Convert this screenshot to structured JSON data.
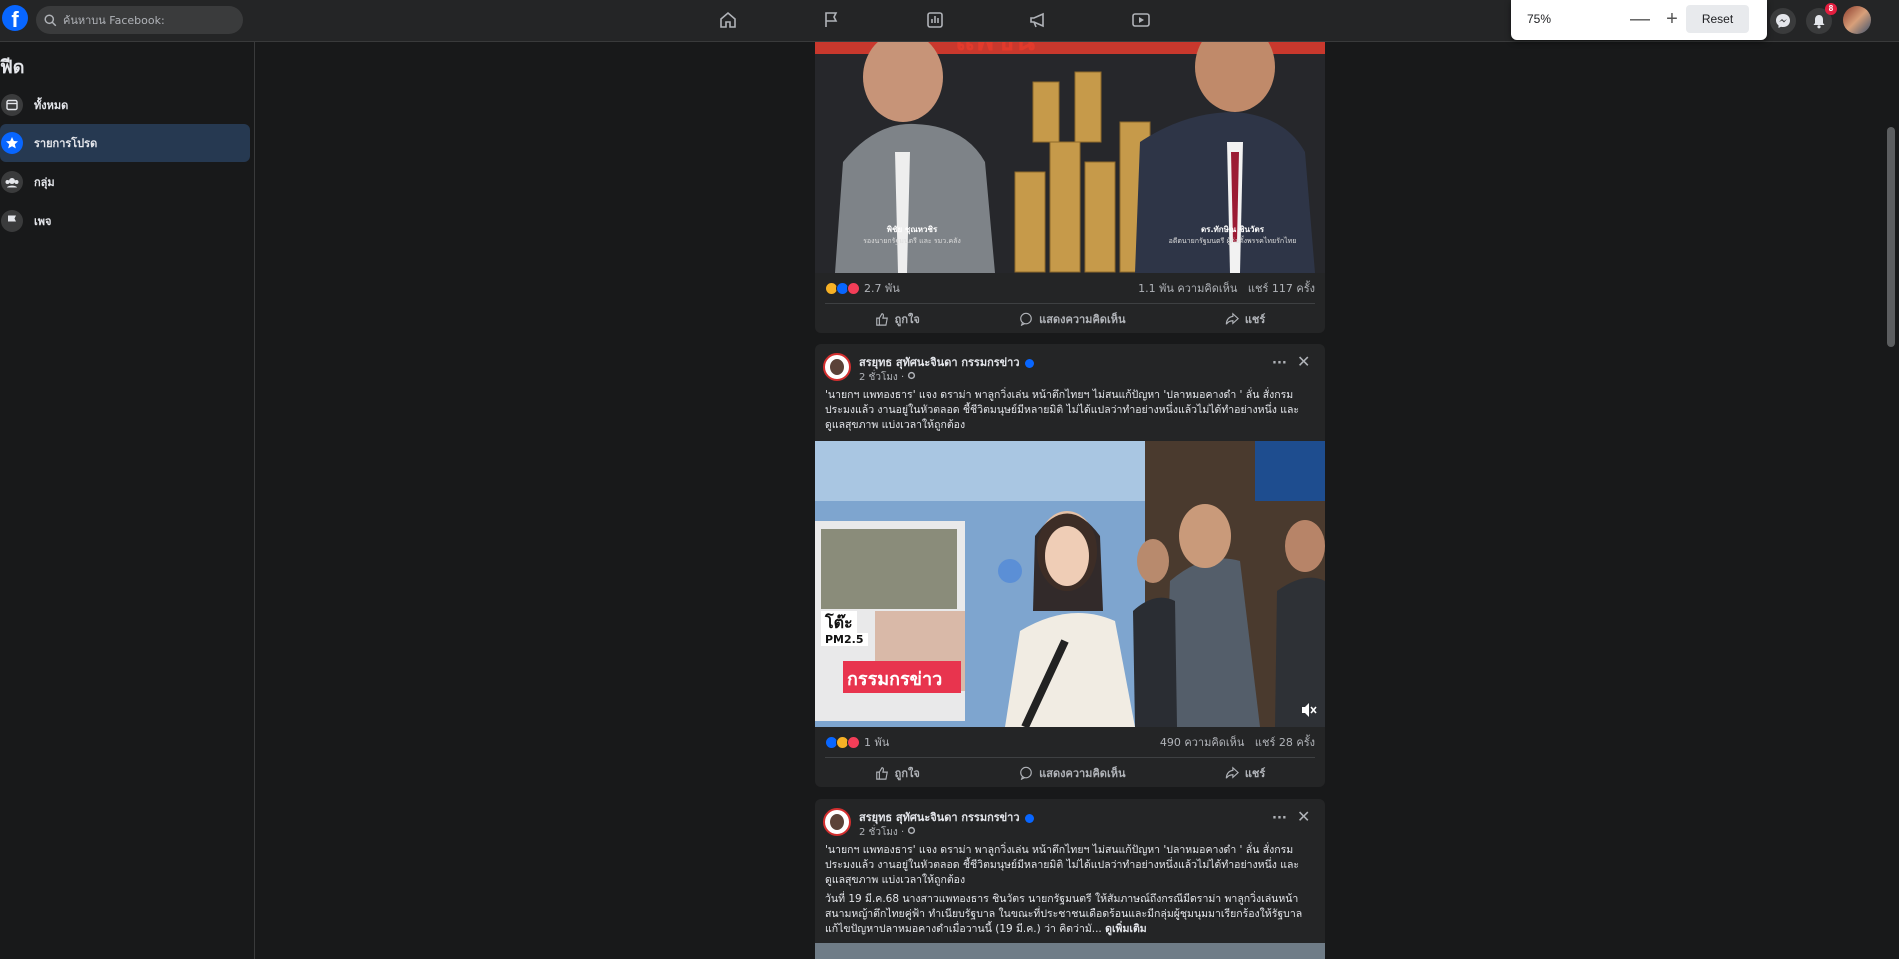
{
  "topbar": {
    "logo": "f",
    "search_placeholder": "ค้นหาบน Facebook:",
    "zoom": {
      "value": "75%",
      "minus": "—",
      "plus": "+",
      "reset": "Reset"
    },
    "notification_count": "8"
  },
  "sidebar": {
    "title": "ฟีด",
    "items": [
      {
        "label": "ทั้งหมด",
        "icon": "feed-icon"
      },
      {
        "label": "รายการโปรด",
        "icon": "star-icon"
      },
      {
        "label": "กลุ่ม",
        "icon": "groups-icon"
      },
      {
        "label": "เพจ",
        "icon": "flag-icon"
      }
    ]
  },
  "posts": [
    {
      "image_captions": [
        {
          "name": "พิชัย ชุณหวชิร",
          "role": "รองนายกรัฐมนตรี และ รมว.คลัง"
        },
        {
          "name": "ดร.ทักษิณ ชินวัตร",
          "role": "อดีตนายกรัฐมนตรี ผู้ก่อตั้งพรรคไทยรักไทย"
        }
      ],
      "reactions": "2.7 พัน",
      "comments": "1.1 พัน ความคิดเห็น",
      "shares": "แชร์ 117 ครั้ง",
      "like": "ถูกใจ",
      "comment": "แสดงความคิดเห็น",
      "share": "แชร์"
    },
    {
      "author": "สรยุทธ สุทัศนะจินดา กรรมกรข่าว",
      "time": "2 ชั่วโมง ·",
      "text": "'นายกฯ แพทองธาร' แจง ดราม่า พาลูกวิ่งเล่น หน้าตึกไทยฯ ไม่สนแก้ปัญหา 'ปลาหมอคางดำ ' ลั่น สั่งกรมประมงแล้ว งานอยู่ในหัวตลอด ชี้ชีวิตมนุษย์มีหลายมิติ ไม่ได้แปลว่าทำอย่างหนึ่งแล้วไม่ได้ทำอย่างหนึ่ง และดูแลสุขภาพ แบ่งเวลาให้ถูกต้อง",
      "video_overlay": "กรรมกรข่าว",
      "video_text_fragment": "โต๊ะ",
      "video_text_fragment2": "PM2.5",
      "reactions": "1 พัน",
      "comments": "490 ความคิดเห็น",
      "shares": "แชร์ 28 ครั้ง",
      "like": "ถูกใจ",
      "comment": "แสดงความคิดเห็น",
      "share": "แชร์"
    },
    {
      "author": "สรยุทธ สุทัศนะจินดา กรรมกรข่าว",
      "time": "2 ชั่วโมง ·",
      "text": "'นายกฯ แพทองธาร' แจง ดราม่า พาลูกวิ่งเล่น หน้าตึกไทยฯ ไม่สนแก้ปัญหา 'ปลาหมอคางดำ ' ลั่น สั่งกรมประมงแล้ว งานอยู่ในหัวตลอด ชี้ชีวิตมนุษย์มีหลายมิติ ไม่ได้แปลว่าทำอย่างหนึ่งแล้วไม่ได้ทำอย่างหนึ่ง และดูแลสุขภาพ แบ่งเวลาให้ถูกต้อง",
      "text2": "วันที่ 19 มี.ค.68 นางสาวแพทองธาร ชินวัตร นายกรัฐมนตรี ให้สัมภาษณ์ถึงกรณีมีดราม่า พาลูกวิ่งเล่นหน้าสนามหญ้าตึกไทยคู่ฟ้า ทำเนียบรัฐบาล ในขณะที่ประชาชนเดือดร้อนและมีกลุ่มผู้ชุมนุมมาเรียกร้องให้รัฐบาลแก้ไขปัญหาปลาหมอคางดำเมื่อวานนี้ (19 มี.ค.) ว่า คิดว่ามั...",
      "see_more": "ดูเพิ่มเติม"
    }
  ],
  "colors": {
    "accent": "#0866ff",
    "background": "#18191a",
    "card": "#242526",
    "overlay_red": "#e8344e"
  }
}
